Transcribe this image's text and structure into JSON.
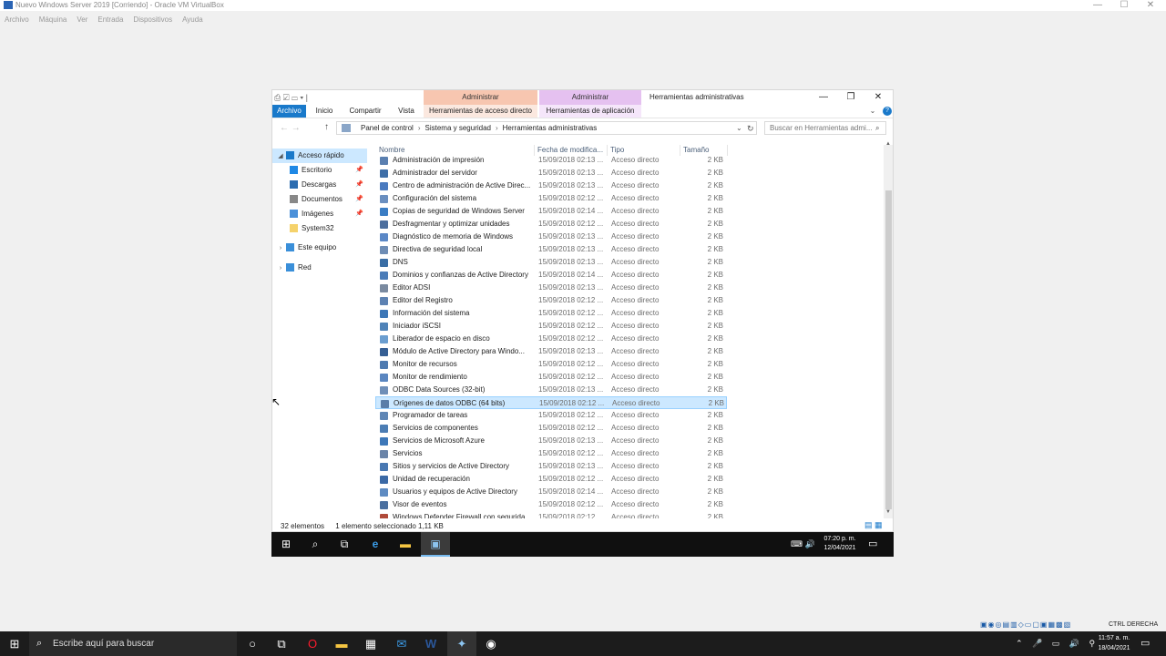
{
  "host_window": {
    "title": "Nuevo Windows Server 2019 [Corriendo] - Oracle VM VirtualBox",
    "menu": [
      "Archivo",
      "Máquina",
      "Ver",
      "Entrada",
      "Dispositivos",
      "Ayuda"
    ],
    "controls": {
      "minimize": "—",
      "maximize": "☐",
      "close": "✕"
    }
  },
  "explorer": {
    "context_tabs": [
      "Administrar",
      "Administrar"
    ],
    "title": "Herramientas administrativas",
    "controls": {
      "minimize": "—",
      "maximize": "❐",
      "close": "✕"
    },
    "qat": "⎙ ☑ ▭ ▾ |",
    "ribbon_tabs": [
      "Archivo",
      "Inicio",
      "Compartir",
      "Vista",
      "Herramientas de acceso directo",
      "Herramientas de aplicación"
    ],
    "ribbon_expand": "⌄",
    "help": "?",
    "address": {
      "crumbs": [
        "Panel de control",
        "Sistema y seguridad",
        "Herramientas administrativas"
      ],
      "separator": "›",
      "dropdown": "⌄",
      "refresh": "↻"
    },
    "nav_arrows": "← →",
    "up_arrow": "↑",
    "search": {
      "placeholder": "Buscar en Herramientas admi...",
      "icon": "⌕"
    },
    "nav_pane": {
      "items": [
        {
          "label": "Acceso rápido",
          "chev": "◢",
          "icon": "star-icon",
          "color": "#1979ca",
          "selected": true,
          "pinned": false
        },
        {
          "label": "Escritorio",
          "icon": "desktop-icon",
          "color": "#1e88e5",
          "pinned": true
        },
        {
          "label": "Descargas",
          "icon": "download-icon",
          "color": "#2b6cb0",
          "pinned": true
        },
        {
          "label": "Documentos",
          "icon": "document-icon",
          "color": "#888888",
          "pinned": true
        },
        {
          "label": "Imágenes",
          "icon": "images-icon",
          "color": "#4a90d9",
          "pinned": true
        },
        {
          "label": "System32",
          "icon": "folder-icon",
          "color": "#f5d26b",
          "pinned": false
        },
        {
          "label": "Este equipo",
          "chev": "›",
          "icon": "computer-icon",
          "color": "#3a8fd9",
          "pinned": false
        },
        {
          "label": "Red",
          "chev": "›",
          "icon": "network-icon",
          "color": "#3a8fd9",
          "pinned": false
        }
      ],
      "pin_glyph": "📌"
    },
    "columns": {
      "name": "Nombre",
      "date": "Fecha de modifica...",
      "type": "Tipo",
      "size": "Tamaño",
      "sort_glyph": "^"
    },
    "rows": [
      {
        "name": "Administración de impresión",
        "date": "15/09/2018 02:13 ...",
        "type": "Acceso directo",
        "size": "2 KB"
      },
      {
        "name": "Administrador del servidor",
        "date": "15/09/2018 02:13 ...",
        "type": "Acceso directo",
        "size": "2 KB"
      },
      {
        "name": "Centro de administración de Active Direc...",
        "date": "15/09/2018 02:13 ...",
        "type": "Acceso directo",
        "size": "2 KB"
      },
      {
        "name": "Configuración del sistema",
        "date": "15/09/2018 02:12 ...",
        "type": "Acceso directo",
        "size": "2 KB"
      },
      {
        "name": "Copias de seguridad de Windows Server",
        "date": "15/09/2018 02:14 ...",
        "type": "Acceso directo",
        "size": "2 KB"
      },
      {
        "name": "Desfragmentar y optimizar unidades",
        "date": "15/09/2018 02:12 ...",
        "type": "Acceso directo",
        "size": "2 KB"
      },
      {
        "name": "Diagnóstico de memoria de Windows",
        "date": "15/09/2018 02:13 ...",
        "type": "Acceso directo",
        "size": "2 KB"
      },
      {
        "name": "Directiva de seguridad local",
        "date": "15/09/2018 02:13 ...",
        "type": "Acceso directo",
        "size": "2 KB"
      },
      {
        "name": "DNS",
        "date": "15/09/2018 02:13 ...",
        "type": "Acceso directo",
        "size": "2 KB"
      },
      {
        "name": "Dominios y confianzas de Active Directory",
        "date": "15/09/2018 02:14 ...",
        "type": "Acceso directo",
        "size": "2 KB"
      },
      {
        "name": "Editor ADSI",
        "date": "15/09/2018 02:13 ...",
        "type": "Acceso directo",
        "size": "2 KB"
      },
      {
        "name": "Editor del Registro",
        "date": "15/09/2018 02:12 ...",
        "type": "Acceso directo",
        "size": "2 KB"
      },
      {
        "name": "Información del sistema",
        "date": "15/09/2018 02:12 ...",
        "type": "Acceso directo",
        "size": "2 KB"
      },
      {
        "name": "Iniciador iSCSI",
        "date": "15/09/2018 02:12 ...",
        "type": "Acceso directo",
        "size": "2 KB"
      },
      {
        "name": "Liberador de espacio en disco",
        "date": "15/09/2018 02:12 ...",
        "type": "Acceso directo",
        "size": "2 KB"
      },
      {
        "name": "Módulo de Active Directory para Windo...",
        "date": "15/09/2018 02:13 ...",
        "type": "Acceso directo",
        "size": "2 KB"
      },
      {
        "name": "Monitor de recursos",
        "date": "15/09/2018 02:12 ...",
        "type": "Acceso directo",
        "size": "2 KB"
      },
      {
        "name": "Monitor de rendimiento",
        "date": "15/09/2018 02:12 ...",
        "type": "Acceso directo",
        "size": "2 KB"
      },
      {
        "name": "ODBC Data Sources (32-bit)",
        "date": "15/09/2018 02:13 ...",
        "type": "Acceso directo",
        "size": "2 KB"
      },
      {
        "name": "Orígenes de datos ODBC (64 bits)",
        "date": "15/09/2018 02:12 ...",
        "type": "Acceso directo",
        "size": "2 KB",
        "selected": true
      },
      {
        "name": "Programador de tareas",
        "date": "15/09/2018 02:12 ...",
        "type": "Acceso directo",
        "size": "2 KB"
      },
      {
        "name": "Servicios de componentes",
        "date": "15/09/2018 02:12 ...",
        "type": "Acceso directo",
        "size": "2 KB"
      },
      {
        "name": "Servicios de Microsoft Azure",
        "date": "15/09/2018 02:13 ...",
        "type": "Acceso directo",
        "size": "2 KB"
      },
      {
        "name": "Servicios",
        "date": "15/09/2018 02:12 ...",
        "type": "Acceso directo",
        "size": "2 KB"
      },
      {
        "name": "Sitios y servicios de Active Directory",
        "date": "15/09/2018 02:13 ...",
        "type": "Acceso directo",
        "size": "2 KB"
      },
      {
        "name": "Unidad de recuperación",
        "date": "15/09/2018 02:12 ...",
        "type": "Acceso directo",
        "size": "2 KB"
      },
      {
        "name": "Usuarios y equipos de Active Directory",
        "date": "15/09/2018 02:14 ...",
        "type": "Acceso directo",
        "size": "2 KB"
      },
      {
        "name": "Visor de eventos",
        "date": "15/09/2018 02:12 ...",
        "type": "Acceso directo",
        "size": "2 KB"
      },
      {
        "name": "Windows Defender Firewall con segurida...",
        "date": "15/09/2018 02:12 ...",
        "type": "Acceso directo",
        "size": "2 KB"
      }
    ],
    "scroll_up": "▲",
    "scroll_down": "▼",
    "status": {
      "count": "32 elementos",
      "selection": "1 elemento seleccionado  1,11 KB"
    },
    "view_buttons": "▤ ▦"
  },
  "guest_taskbar": {
    "buttons": [
      {
        "name": "start-button",
        "glyph": "⊞"
      },
      {
        "name": "search-button",
        "glyph": "⌕"
      },
      {
        "name": "task-view-button",
        "glyph": "⧉"
      },
      {
        "name": "ie-button",
        "glyph": "e"
      },
      {
        "name": "explorer-button",
        "glyph": "▬"
      },
      {
        "name": "admin-tools-button",
        "glyph": "▣"
      }
    ],
    "tray": "⌨ 🔊",
    "time": "07:20 p. m.",
    "date": "12/04/2021",
    "notif": "▭"
  },
  "vbox_status": {
    "icons": "▣◉◎▤▥◇▭▢▣▦▩▧",
    "host_key": "CTRL DERECHA"
  },
  "host_taskbar": {
    "start": "⊞",
    "search_icon": "⌕",
    "search_text": "Escribe aquí para buscar",
    "buttons": [
      {
        "name": "cortana-button",
        "glyph": "○"
      },
      {
        "name": "task-view-button",
        "glyph": "⧉"
      },
      {
        "name": "opera-button",
        "glyph": "O"
      },
      {
        "name": "file-explorer-button",
        "glyph": "▬"
      },
      {
        "name": "store-button",
        "glyph": "▦"
      },
      {
        "name": "mail-button",
        "glyph": "✉"
      },
      {
        "name": "word-button",
        "glyph": "W"
      },
      {
        "name": "virtualbox-button",
        "glyph": "✦"
      },
      {
        "name": "chrome-button",
        "glyph": "◉"
      }
    ],
    "tray": "⌃ 🎤 ▭ 🔊 ⚲",
    "time": "11:57 a. m.",
    "date": "18/04/2021",
    "notif": "▭"
  },
  "cursor": "↖",
  "colors": {
    "accent": "#1979ca",
    "selection": "#cce8ff",
    "context_admin_1": "#f7c6b0",
    "context_admin_2": "#e5c1f0"
  }
}
